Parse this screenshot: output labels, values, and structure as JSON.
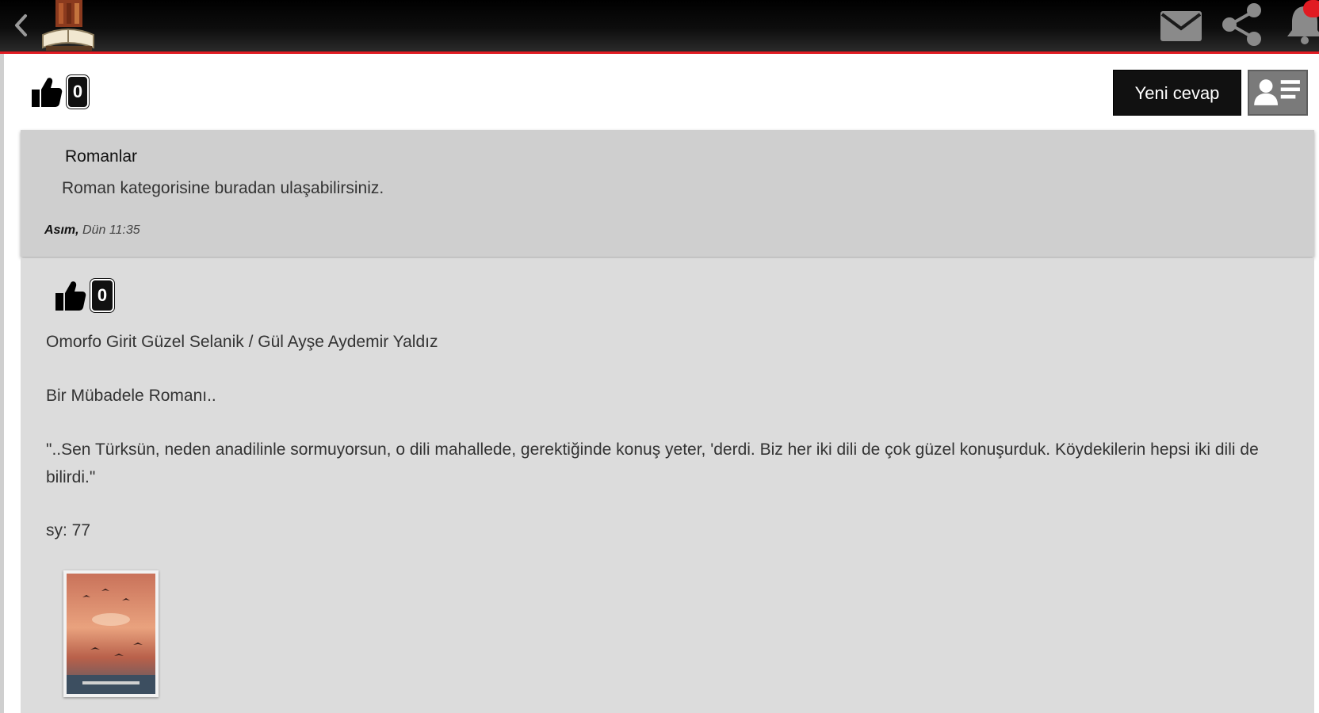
{
  "colors": {
    "accent": "#e11b22",
    "topbar": "#000000",
    "card_header": "#cfcfcf",
    "card_body": "#dcdcdc"
  },
  "topbar": {
    "icons": [
      "back-icon",
      "logo",
      "mail-icon",
      "share-icon",
      "bell-icon"
    ],
    "notification_badge": ""
  },
  "topic_likes": {
    "count": "0"
  },
  "actions": {
    "reply_label": "Yeni cevap",
    "profile_icon": "user-list-icon"
  },
  "category": {
    "title": "Romanlar",
    "description": "Roman kategorisine buradan ulaşabilirsiniz.",
    "author": "Asım,",
    "time": " Dün 11:35"
  },
  "post": {
    "likes": "0",
    "lines": [
      "Omorfo Girit Güzel Selanik / Gül Ayşe Aydemir Yaldız",
      "Bir Mübadele Romanı..",
      "\"..Sen Türksün, neden anadilinle sormuyorsun, o dili mahallede, gerektiğinde konuş yeter, 'derdi. Biz her iki dili de çok güzel konuşurduk. Köydekilerin hepsi iki dili de bilirdi.\"",
      "sy: 77"
    ],
    "image": "book-cover"
  }
}
